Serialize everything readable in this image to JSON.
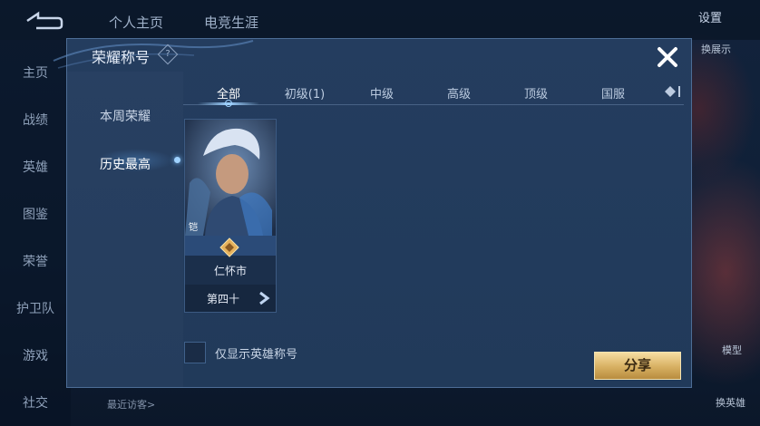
{
  "top_tabs": [
    "个人主页",
    "电竞生涯"
  ],
  "settings_label": "设置",
  "left_nav": [
    "主页",
    "战绩",
    "英雄",
    "图鉴",
    "荣誉",
    "护卫队",
    "游戏",
    "社交"
  ],
  "bottom": {
    "recent_visitors": "最近访客>"
  },
  "right_labels": [
    "换展示",
    "模型",
    "换英雄"
  ],
  "modal": {
    "title": "荣耀称号",
    "help": "?",
    "close": "✕",
    "nav": [
      "本周荣耀",
      "历史最高"
    ],
    "active_nav": "历史最高",
    "tabs": [
      "全部",
      "初级(1)",
      "中级",
      "高级",
      "顶级",
      "国服"
    ],
    "active_tab": "全部",
    "more_tab_icon": "diamond-icon",
    "card": {
      "hero_name": "铠",
      "region": "仁怀市",
      "rank": "第四十",
      "emblem": "honor-emblem-icon"
    },
    "checkbox_label": "仅显示英雄称号",
    "share_label": "分享"
  },
  "colors": {
    "accent": "#9fd2ff",
    "share_button": "#d7b062",
    "panel": "#213a5a"
  }
}
